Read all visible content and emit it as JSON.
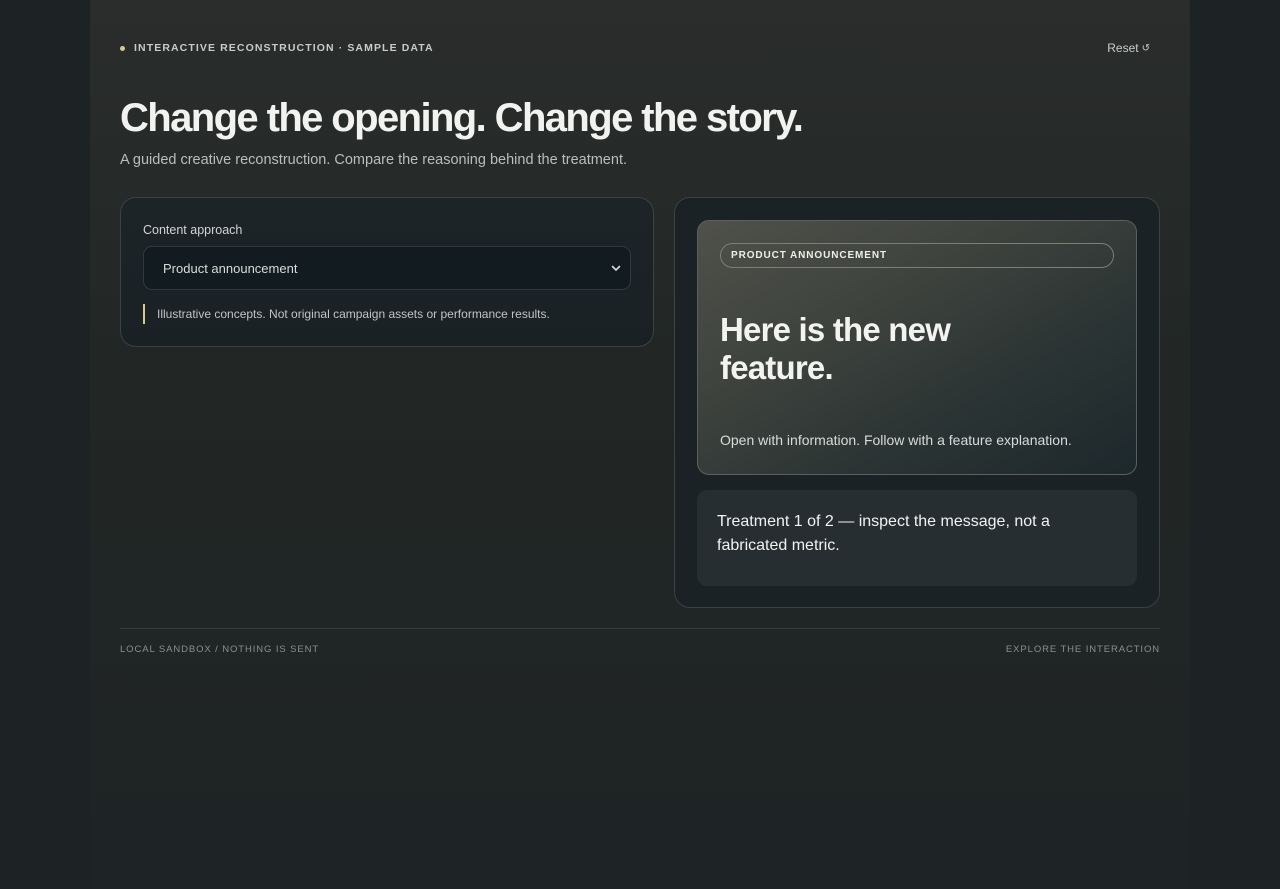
{
  "header": {
    "eyebrow": "INTERACTIVE RECONSTRUCTION · SAMPLE DATA",
    "reset_label": "Reset",
    "title": "Change the opening. Change the story.",
    "subtitle": "A guided creative reconstruction. Compare the reasoning behind the treatment."
  },
  "controls": {
    "field_label": "Content approach",
    "selected_option": "Product announcement",
    "note": "Illustrative concepts. Not original campaign assets or performance results."
  },
  "preview": {
    "tag": "PRODUCT ANNOUNCEMENT",
    "headline": "Here is the new feature.",
    "body": "Open with information. Follow with a feature explanation."
  },
  "status": {
    "text": "Treatment 1 of 2 — inspect the message, not a fabricated metric."
  },
  "footer": {
    "left": "LOCAL SANDBOX / NOTHING IS SENT",
    "right": "EXPLORE THE INTERACTION"
  },
  "colors": {
    "accent": "#d8c98a",
    "background": "#1d2224"
  },
  "icons": {
    "reset": "reset-icon",
    "select": "chevron-down-icon"
  }
}
